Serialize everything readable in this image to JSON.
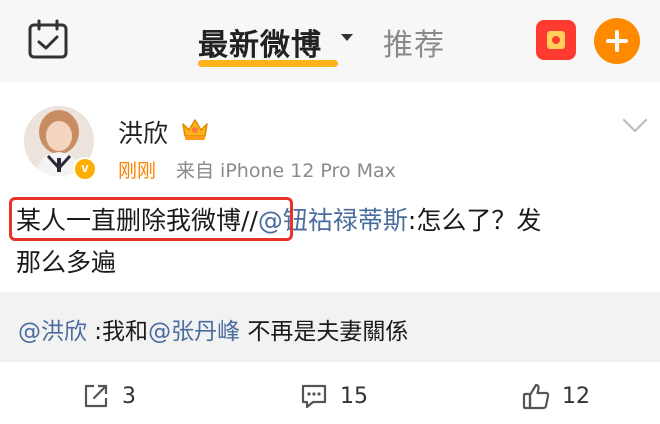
{
  "header": {
    "tab_latest": "最新微博",
    "tab_recommend": "推荐",
    "accent_color": "#ffb21c",
    "icons": [
      "calendar-icon",
      "caret-down-icon",
      "red-packet-icon",
      "plus-icon"
    ]
  },
  "post": {
    "user_name": "洪欣",
    "time": "刚刚",
    "source": "来自 iPhone 12 Pro Max",
    "body_highlight": "某人一直删除我微博",
    "body_sep": "//",
    "body_mention": "@钮祜禄蒂斯",
    "body_rest_line1": ":怎么了？发",
    "body_line2": "那么多遍",
    "repost_mention1": "@洪欣",
    "repost_text1": " :我和",
    "repost_mention2": "@张丹峰",
    "repost_text2": " 不再是夫妻關係",
    "watermark": "@洪欣",
    "time_color": "#ff8200",
    "mention_color": "#4a6d9d",
    "highlight_border_color": "#e8332b"
  },
  "actions": {
    "share_count": "3",
    "comment_count": "15",
    "like_count": "12"
  }
}
